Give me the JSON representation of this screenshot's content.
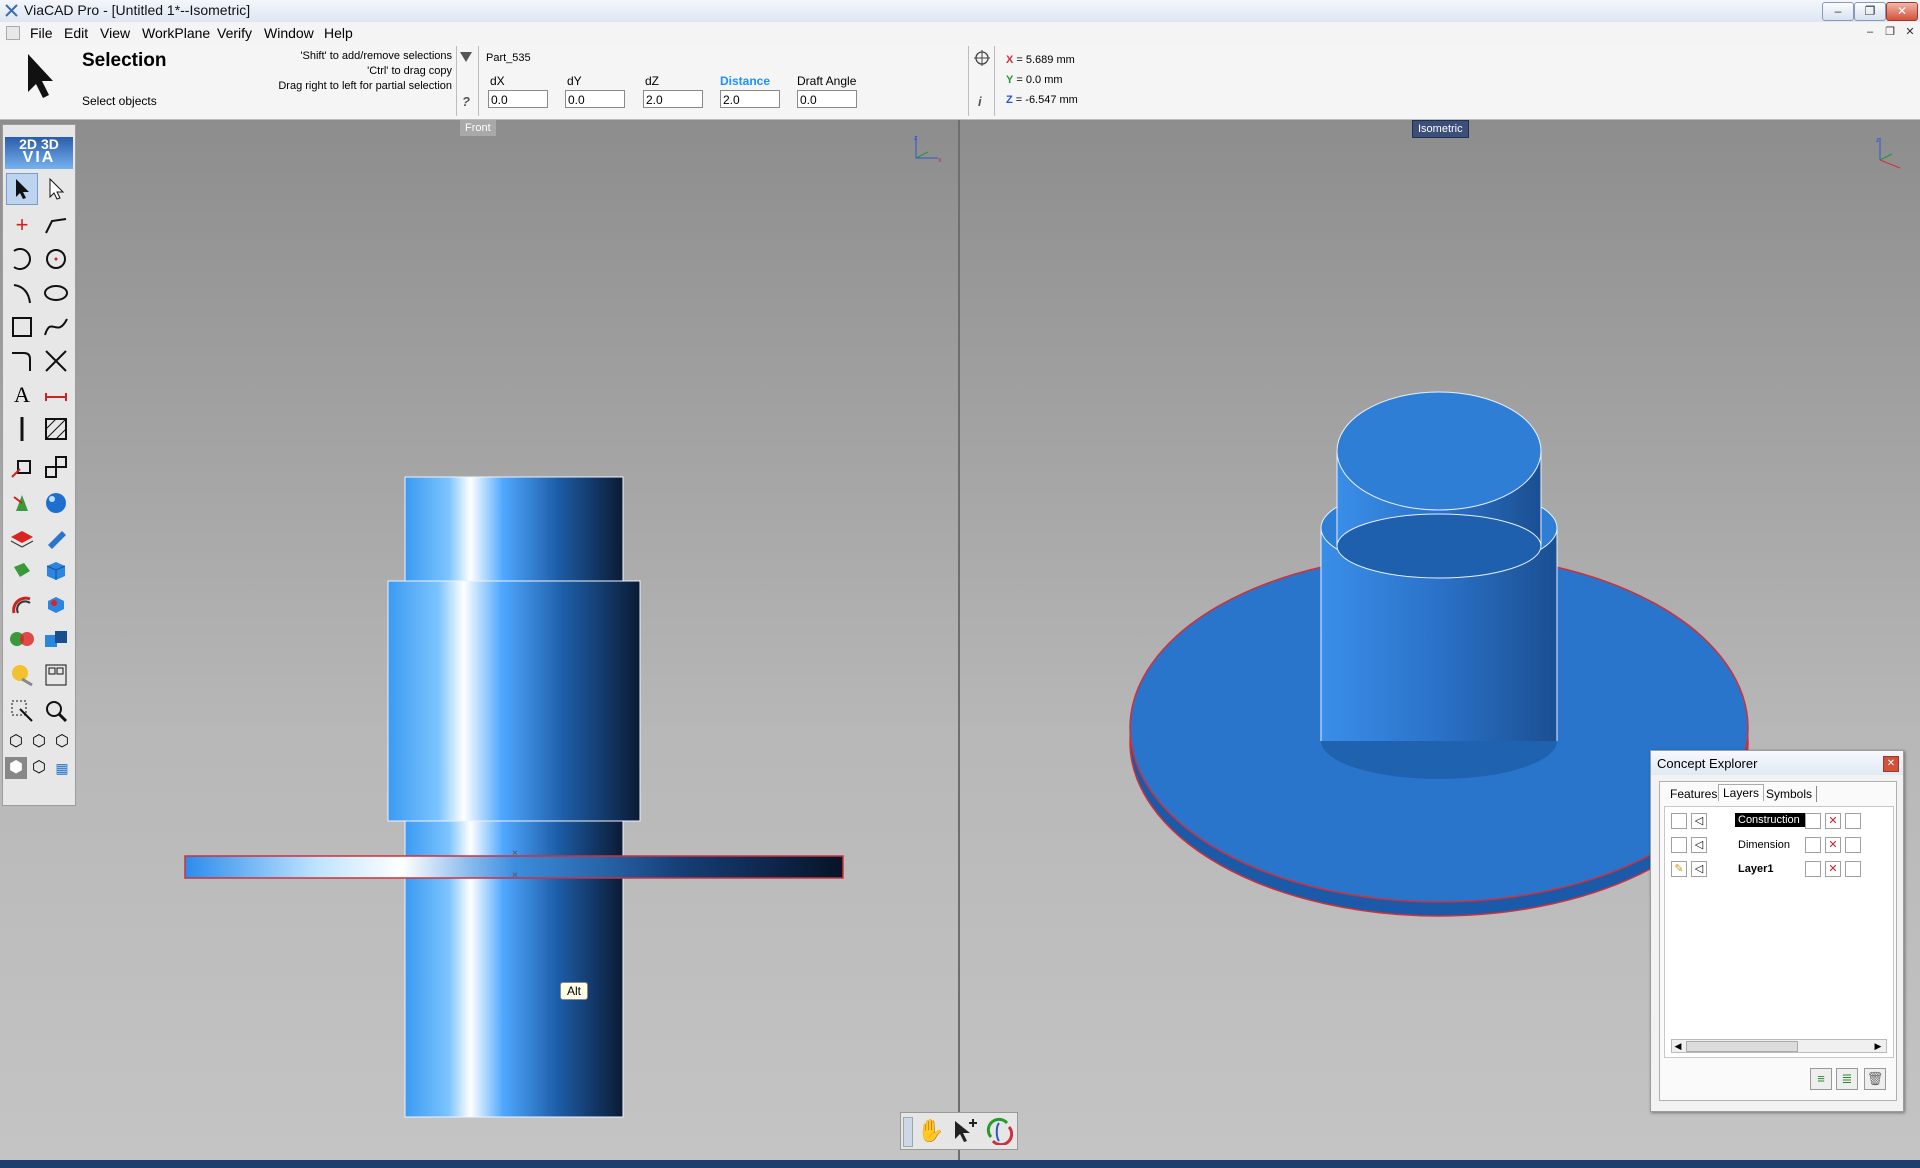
{
  "window": {
    "title": "ViaCAD Pro - [Untitled 1*--Isometric]",
    "min": "–",
    "max": "❐",
    "close": "✕"
  },
  "menu": [
    "File",
    "Edit",
    "View",
    "WorkPlane",
    "Verify",
    "Window",
    "Help"
  ],
  "info": {
    "mode_title": "Selection",
    "mode_hint": "Select objects",
    "help_lines": [
      "'Shift' to add/remove selections",
      "'Ctrl' to drag copy",
      "Drag right to left for partial selection"
    ],
    "help_symbol": "?",
    "part_name": "Part_535",
    "fields": [
      {
        "label": "dX",
        "value": "0.0"
      },
      {
        "label": "dY",
        "value": "0.0"
      },
      {
        "label": "dZ",
        "value": "2.0"
      },
      {
        "label": "Distance",
        "value": "2.0"
      },
      {
        "label": "Draft Angle",
        "value": "0.0"
      }
    ],
    "coords": {
      "x_label": "X",
      "x": "= 5.689 mm",
      "y_label": "Y",
      "y": "= 0.0 mm",
      "z_label": "Z",
      "z": "= -6.547 mm"
    },
    "info_symbol": "i"
  },
  "viewports": {
    "left_label": "Front",
    "right_label": "Isometric",
    "tooltip": "Alt"
  },
  "toolbox": {
    "logo_2d": "2D",
    "logo_3d": "3D",
    "logo_via": "VIA"
  },
  "explorer": {
    "title": "Concept Explorer",
    "tabs": [
      "Features",
      "Layers",
      "Symbols"
    ],
    "active_tab": "Layers",
    "layers": [
      {
        "name": "Construction",
        "selected": true,
        "active": false
      },
      {
        "name": "Dimension",
        "selected": false,
        "active": false
      },
      {
        "name": "Layer1",
        "selected": false,
        "active": true
      }
    ]
  },
  "colors": {
    "accent": "#1e90ff",
    "part_blue": "#2a75cc",
    "edge_red": "#d0303a"
  }
}
